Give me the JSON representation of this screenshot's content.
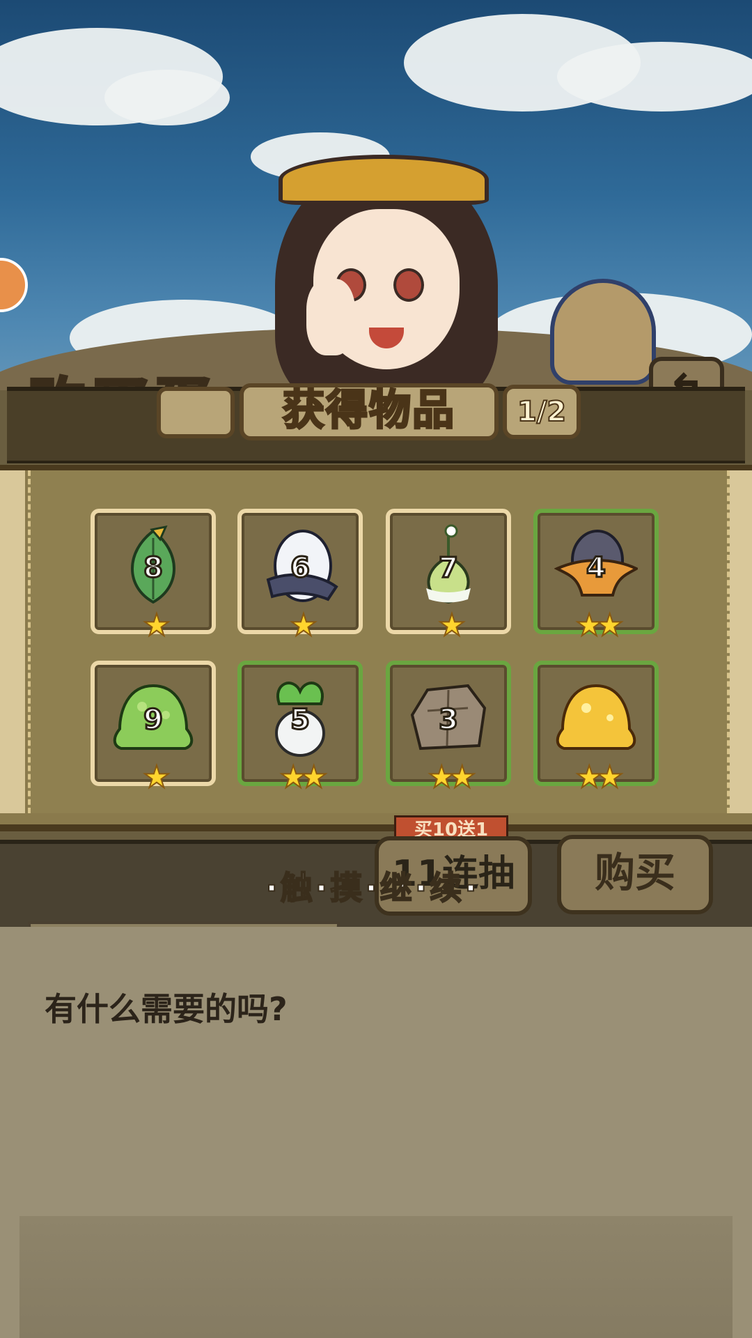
{
  "header": {
    "shop_title": "购买蛋",
    "dialog_title": "获得物品",
    "page_indicator": "1/2",
    "back_icon": "back-arrow-icon"
  },
  "items": [
    {
      "name": "leaf-bud",
      "count": "8",
      "stars": "★",
      "rarity": "normal"
    },
    {
      "name": "white-egg",
      "count": "6",
      "stars": "★",
      "rarity": "normal"
    },
    {
      "name": "green-bulb",
      "count": "7",
      "stars": "★",
      "rarity": "normal"
    },
    {
      "name": "hat-egg",
      "count": "4",
      "stars": "★★",
      "rarity": "green"
    },
    {
      "name": "green-slime",
      "count": "9",
      "stars": "★",
      "rarity": "normal"
    },
    {
      "name": "turnip",
      "count": "5",
      "stars": "★★",
      "rarity": "green"
    },
    {
      "name": "rock-golem",
      "count": "3",
      "stars": "★★",
      "rarity": "green"
    },
    {
      "name": "gold-slime",
      "count": "",
      "stars": "★★",
      "rarity": "green"
    }
  ],
  "bottom": {
    "touch_continue": "·触·摸·继·续·",
    "eleven_pull_label": "11连抽",
    "eleven_pull_tag": "买10送1",
    "buy_label": "购买"
  },
  "dialog": {
    "text": "有什么需要的吗?"
  },
  "colors": {
    "card_border_normal": "#ecd8a8",
    "card_border_rare": "#6aa640",
    "star": "#ffd52e"
  }
}
